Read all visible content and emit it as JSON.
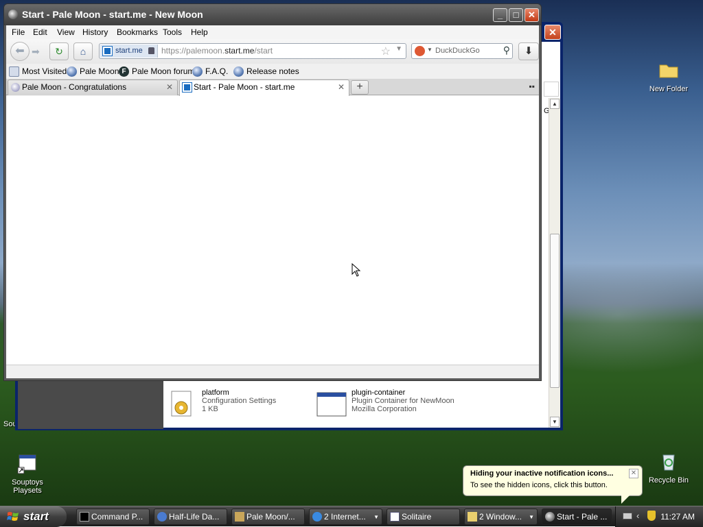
{
  "browser": {
    "title": "Start - Pale Moon - start.me - New Moon",
    "menu": [
      "File",
      "Edit",
      "View",
      "History",
      "Bookmarks",
      "Tools",
      "Help"
    ],
    "url_identity": "start.me",
    "url_prefix": "https://palemoon.",
    "url_domain": "start.me",
    "url_path": "/start",
    "search_engine": "DuckDuckGo",
    "bookmarks": [
      "Most Visited",
      "Pale Moon",
      "Pale Moon forum",
      "F.A.Q.",
      "Release notes"
    ],
    "tabs": [
      {
        "label": "Pale Moon - Congratulations",
        "active": false
      },
      {
        "label": "Start - Pale Moon - start.me",
        "active": true
      }
    ]
  },
  "background_window": {
    "go_label": "Go",
    "files": [
      {
        "name": "platform",
        "line1": "Configuration Settings",
        "line2": "1 KB"
      },
      {
        "name": "plugin-container",
        "line1": "Plugin Container for NewMoon",
        "line2": "Mozilla Corporation"
      }
    ]
  },
  "desktop": {
    "icons": [
      "New Folder",
      "Recycle Bin",
      "Souptoys Playsets"
    ],
    "partial_label": "Sou"
  },
  "notification": {
    "title": "Hiding your inactive notification icons...",
    "text": "To see the hidden icons, click this button."
  },
  "taskbar": {
    "start_label": "start",
    "buttons": [
      "Command P...",
      "Half-Life Da...",
      "Pale Moon/...",
      "2 Internet...",
      "Solitaire",
      "2 Window...",
      "Start - Pale ..."
    ],
    "clock": "11:27 AM"
  },
  "colors": {
    "accent": "#1a6cc0",
    "close_red": "#c13a16",
    "balloon_bg": "#ffffe1"
  }
}
